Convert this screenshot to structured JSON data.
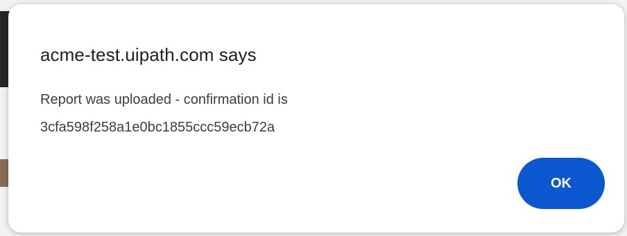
{
  "dialog": {
    "title": "acme-test.uipath.com says",
    "message_line_1": "Report was uploaded - confirmation id is",
    "message_line_2": "3cfa598f258a1e0bc1855ccc59ecb72a",
    "ok_label": "OK"
  },
  "colors": {
    "button_background": "#0b57d0",
    "button_text": "#ffffff",
    "title_text": "#1f1f1f",
    "message_text": "#3c3c3c"
  }
}
